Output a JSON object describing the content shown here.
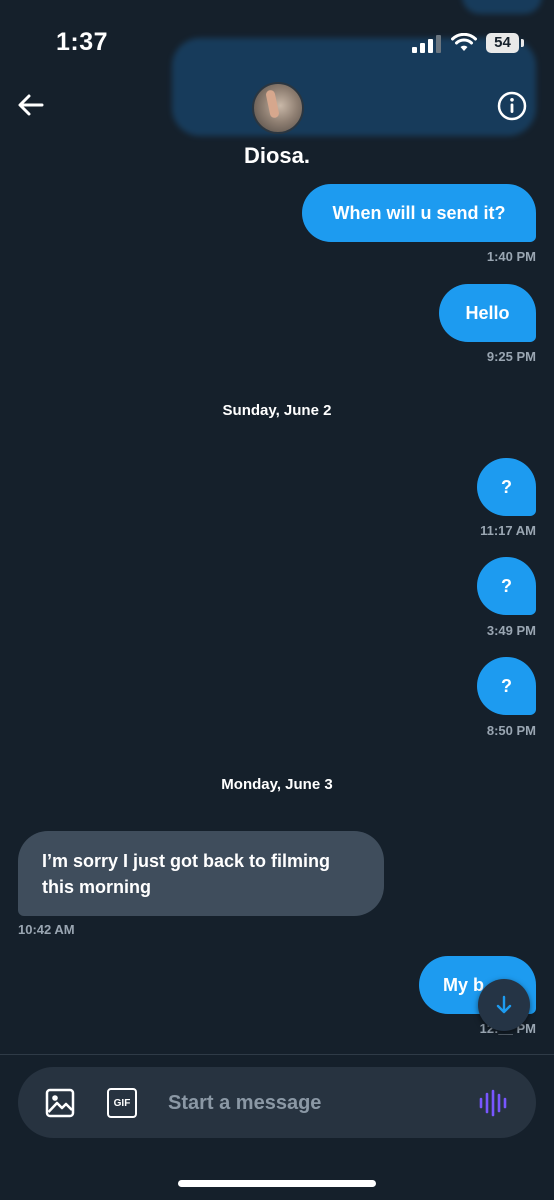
{
  "status_bar": {
    "time": "1:37",
    "battery": "54"
  },
  "header": {
    "contact_name": "Diosa."
  },
  "messages": [
    {
      "text": "When will u send it?",
      "time": "1:40 PM"
    },
    {
      "text": "Hello",
      "time": "9:25 PM"
    },
    {
      "date": "Sunday, June 2"
    },
    {
      "text": "?",
      "time": "11:17 AM"
    },
    {
      "text": "?",
      "time": "3:49 PM"
    },
    {
      "text": "?",
      "time": "8:50 PM"
    },
    {
      "date": "Monday, June 3"
    },
    {
      "text": "I’m sorry I just got back to filming this morning",
      "time": "10:42 AM"
    },
    {
      "text": "My b",
      "time": "12:__ PM"
    }
  ],
  "composer": {
    "placeholder": "Start a message",
    "gif_label": "GIF"
  },
  "colors": {
    "background": "#15202b",
    "sent_bubble": "#1d9bf0",
    "received_bubble": "#3f4d5c",
    "voice_accent": "#7856ff"
  },
  "icons": [
    "back-arrow-icon",
    "info-icon",
    "image-icon",
    "gif-icon",
    "voice-wave-icon",
    "arrow-down-icon"
  ]
}
